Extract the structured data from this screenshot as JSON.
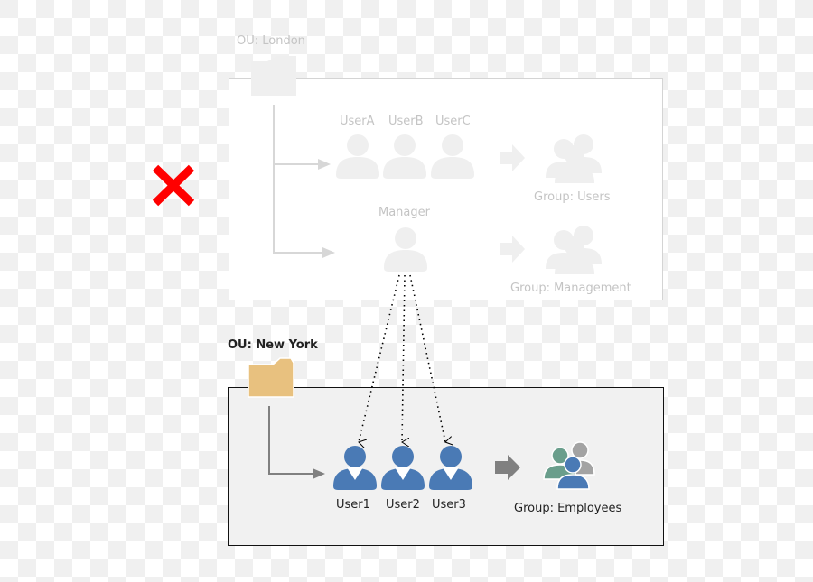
{
  "diagram": {
    "london": {
      "ou_label": "OU: London",
      "status": "rejected",
      "status_icon": "red-x-icon",
      "users": [
        {
          "label": "UserA"
        },
        {
          "label": "UserB"
        },
        {
          "label": "UserC"
        }
      ],
      "manager_label": "Manager",
      "group_users_label": "Group: Users",
      "group_management_label": "Group: Management"
    },
    "new_york": {
      "ou_label": "OU: New York",
      "users": [
        {
          "label": "User1"
        },
        {
          "label": "User2"
        },
        {
          "label": "User3"
        }
      ],
      "group_label": "Group: Employees"
    },
    "colors": {
      "faded": "#efefef",
      "faded_text": "#c4c4c4",
      "user_blue": "#4a7ab5",
      "folder": "#e8c17f",
      "arrow_gray": "#808080",
      "reject_red": "#ff0000",
      "group_green": "#6a9e8c",
      "group_gray": "#a3a3a3"
    }
  }
}
